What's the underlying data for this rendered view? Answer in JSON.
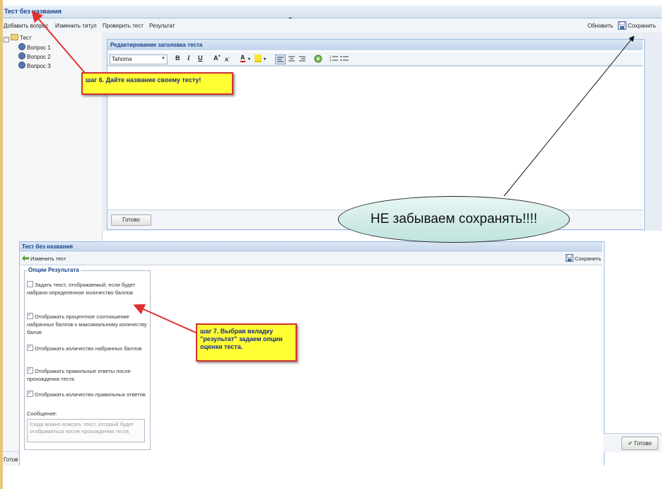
{
  "window": {
    "title": "Тест без названия"
  },
  "toolbar": {
    "add_question": "Добавить вопрос",
    "edit_title": "Изменить титул",
    "check_test": "Проверить тест",
    "result": "Результат",
    "refresh": "Обновить",
    "save": "Сохранить"
  },
  "tree": {
    "root": "Тест",
    "items": [
      "Вопрос 1",
      "Вопрос 2",
      "Вопрос 3"
    ]
  },
  "editor": {
    "panel_title": "Редактирование заголовка теста",
    "font": "Tahoma",
    "done": "Готово"
  },
  "callouts": {
    "step6": "шаг 6. Дайте название своему тесту!",
    "step7": "шаг 7. Выбрав вкладку \"результат\" задаем опции оценки теста.",
    "save_reminder": "НЕ забываем сохранять!!!!"
  },
  "result_panel": {
    "title": "Тест без названия",
    "edit_test": "Изменить тест",
    "save": "Сохранить",
    "legend": "Опции Результата",
    "options": [
      {
        "label": "Задать текст, отображаемый, если будет набрано определенное количество баллов",
        "checked": false
      },
      {
        "label": "Отображать процентное соотношение набранных баллов к максимальному количеству балов",
        "checked": true
      },
      {
        "label": "Отображать количество набранных баллов",
        "checked": true
      },
      {
        "label": "Отображать правильные ответы после прохождения теста",
        "checked": true
      },
      {
        "label": "Отображать количество правильных ответов",
        "checked": true
      }
    ],
    "message_label": "Сообщение:",
    "message_placeholder": "Сюда можно вписать текст, который будет отобраматься после прохождения теста",
    "done": "Готово"
  },
  "status": {
    "left": "Готов"
  },
  "colors": {
    "callout_bg": "#ffff33",
    "callout_border": "#cc3333",
    "arrow": "#e03030",
    "accent": "#15428b"
  }
}
